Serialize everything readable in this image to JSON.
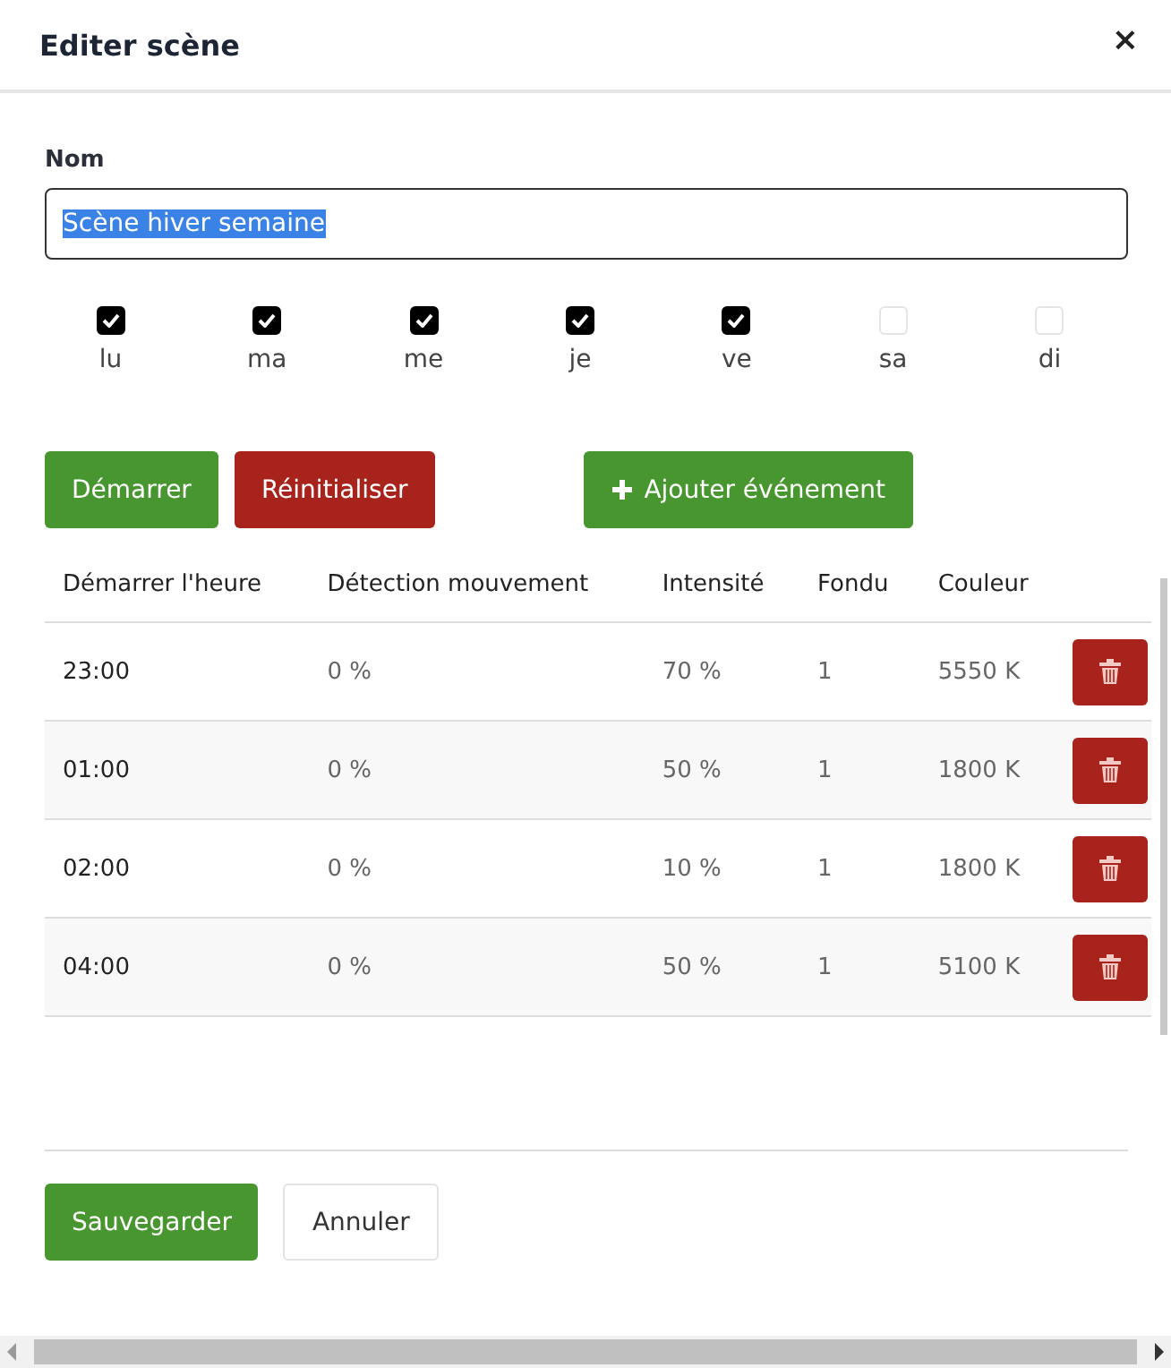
{
  "dialog": {
    "title": "Editer scène",
    "close": "×"
  },
  "name_field": {
    "label": "Nom",
    "value": "Scène hiver semaine",
    "selected_text": true
  },
  "days": [
    {
      "label": "lu",
      "checked": true
    },
    {
      "label": "ma",
      "checked": true
    },
    {
      "label": "me",
      "checked": true
    },
    {
      "label": "je",
      "checked": true
    },
    {
      "label": "ve",
      "checked": true
    },
    {
      "label": "sa",
      "checked": false
    },
    {
      "label": "di",
      "checked": false
    }
  ],
  "actions": [
    {
      "label": "Démarrer",
      "kind": "success"
    },
    {
      "label": "Réinitialiser",
      "kind": "danger"
    },
    {
      "label": "Ajouter événement",
      "kind": "add"
    }
  ],
  "table": {
    "columns": [
      "Démarrer l'heure",
      "Détection mouvement",
      "Intensité",
      "Fondu",
      "Couleur"
    ],
    "rows": [
      [
        "23:00",
        "0 %",
        "70 %",
        "1",
        "5550 K"
      ],
      [
        "01:00",
        "0 %",
        "50 %",
        "1",
        "1800 K"
      ],
      [
        "02:00",
        "0 %",
        "10 %",
        "1",
        "1800 K"
      ],
      [
        "04:00",
        "0 %",
        "50 %",
        "1",
        "5100 K"
      ]
    ]
  },
  "footer": [
    {
      "label": "Sauvegarder",
      "kind": "primary"
    },
    {
      "label": "Annuler",
      "kind": "default"
    }
  ]
}
